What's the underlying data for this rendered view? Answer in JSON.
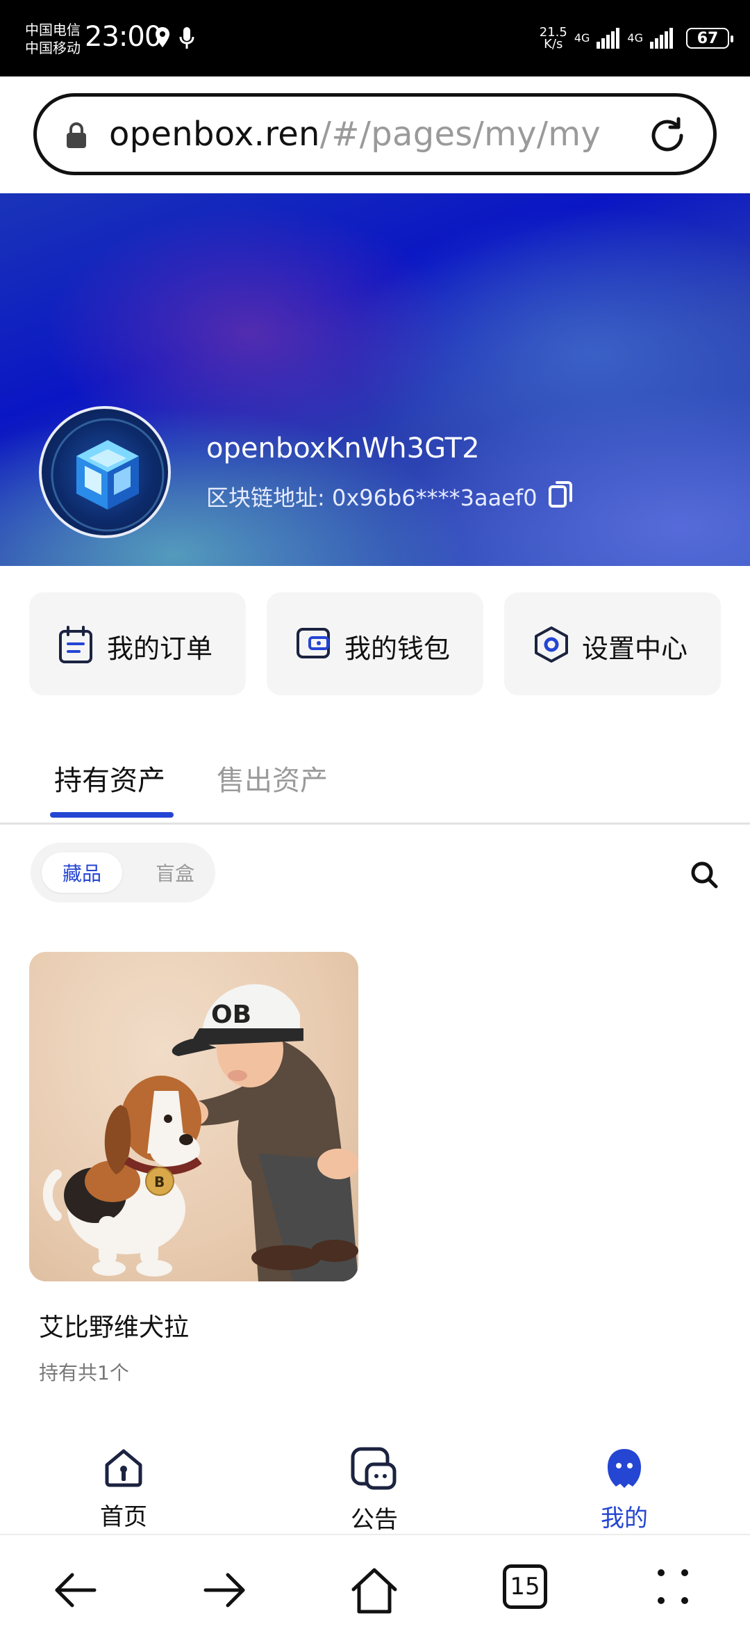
{
  "status_bar": {
    "carrier_1": "中国电信",
    "carrier_2": "中国移动",
    "time": "23:00",
    "net_speed_value": "21.5",
    "net_speed_unit": "K/s",
    "network_1": "4G",
    "network_2": "4G",
    "battery": "67"
  },
  "browser": {
    "url_domain": "openbox.ren",
    "url_path": "/#/pages/my/my",
    "tab_count": "15"
  },
  "profile": {
    "username": "openboxKnWh3GT2",
    "address_label": "区块链地址:",
    "address_value": "0x96b6****3aaef0"
  },
  "quick_actions": {
    "orders": "我的订单",
    "wallet": "我的钱包",
    "settings": "设置中心"
  },
  "tabs": {
    "held": "持有资产",
    "sold": "售出资产"
  },
  "segment": {
    "collectibles": "藏品",
    "blind_box": "盲盒"
  },
  "items": [
    {
      "title": "艾比野维犬拉",
      "count_text": "持有共1个",
      "hat_text": "OB",
      "tag_text": "B"
    }
  ],
  "bottom_nav": {
    "home": "首页",
    "notice": "公告",
    "me": "我的"
  },
  "colors": {
    "accent": "#2545d3",
    "inactive_text": "#9a9a9a"
  }
}
